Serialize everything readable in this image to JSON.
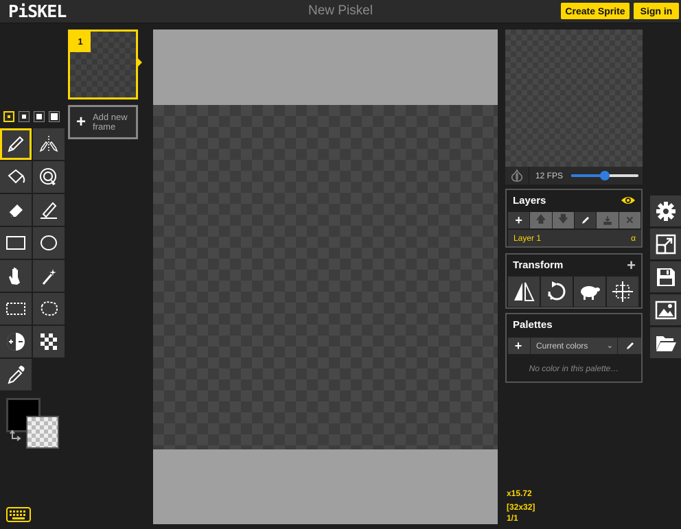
{
  "header": {
    "logo_text": "PiSKEL",
    "title": "New Piskel",
    "create_sprite_label": "Create Sprite",
    "sign_in_label": "Sign in"
  },
  "colors": {
    "accent": "#ffd700",
    "header_bg": "#2b2b2b",
    "panel_bg": "#1e1e1e",
    "slider": "#2f7de1",
    "primary_color": "#000000",
    "secondary_color": "transparent"
  },
  "tools": {
    "pen_sizes": [
      1,
      2,
      3,
      4
    ],
    "selected_pen_size": 1,
    "selected": "pen",
    "items": [
      {
        "name": "pen",
        "icon": "pencil-icon"
      },
      {
        "name": "vertical-mirror-pen",
        "icon": "mirror-pen-icon"
      },
      {
        "name": "paint-bucket",
        "icon": "paint-bucket-icon"
      },
      {
        "name": "paint-all-same-color",
        "icon": "magic-bucket-icon"
      },
      {
        "name": "eraser",
        "icon": "eraser-icon"
      },
      {
        "name": "stroke",
        "icon": "line-icon"
      },
      {
        "name": "rectangle",
        "icon": "rectangle-icon"
      },
      {
        "name": "circle",
        "icon": "circle-icon"
      },
      {
        "name": "move",
        "icon": "hand-icon"
      },
      {
        "name": "shape-selection",
        "icon": "magic-wand-icon"
      },
      {
        "name": "rectangle-selection",
        "icon": "rect-select-icon"
      },
      {
        "name": "lasso-selection",
        "icon": "lasso-icon"
      },
      {
        "name": "lighten",
        "icon": "lighten-icon"
      },
      {
        "name": "dithering",
        "icon": "dithering-icon"
      },
      {
        "name": "color-picker",
        "icon": "eyedropper-icon"
      }
    ]
  },
  "frames": {
    "items": [
      {
        "number": "1"
      }
    ],
    "add_frame_label": "Add new frame"
  },
  "preview": {
    "fps_label": "12 FPS",
    "fps": 12,
    "fps_max": 24
  },
  "layers": {
    "title": "Layers",
    "items": [
      {
        "name": "Layer 1",
        "alpha": "α"
      }
    ]
  },
  "transform": {
    "title": "Transform",
    "tools": [
      "flip-icon",
      "rotate-icon",
      "clone-icon",
      "center-icon"
    ]
  },
  "palettes": {
    "title": "Palettes",
    "selected": "Current colors",
    "empty_text": "No color in this palette…"
  },
  "side_panel": [
    "settings-icon",
    "resize-icon",
    "save-icon",
    "export-image-icon",
    "open-folder-icon"
  ],
  "status": {
    "zoom": "x15.72",
    "size": "[32x32]",
    "frame_index": "1/1"
  }
}
